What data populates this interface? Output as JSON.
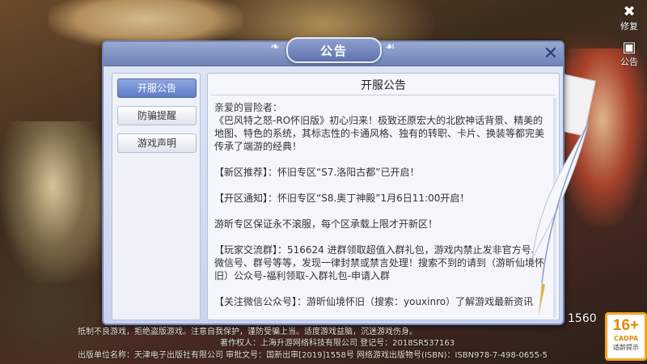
{
  "dialog": {
    "title": "公告",
    "close_icon": "close-x-icon"
  },
  "tabs": [
    {
      "label": "开服公告",
      "active": true
    },
    {
      "label": "防骗提醒",
      "active": false
    },
    {
      "label": "游戏声明",
      "active": false
    }
  ],
  "content": {
    "title": "开服公告",
    "paragraphs": [
      "亲爱的冒险者：",
      "《巴风特之怒-RO怀旧版》初心归来！极致还原宏大的北欧神话背景、精美的地图、特色的系统，其标志性的卡通风格、独有的转职、卡片、换装等都完美传承了端游的经典！",
      "【新区推荐】：怀旧专区“S7.洛阳古都”已开启！",
      "【开区通知】：怀旧专区“S8.奥丁神殿”1月6日11:00开启！",
      " 游昕专区保证永不滚服，每个区承载上限才开新区！",
      "【玩家交流群】：516624 进群领取超值入群礼包，游戏内禁止发非官方号、微信号、群号等等，发现一律封禁或禁言处理！搜索不到的请到（游昕仙境怀旧）公众号-福利领取-入群礼包-申请入群",
      "【关注微信公众号】：游昕仙境怀旧（搜索：youxinro）了解游戏最新资讯"
    ]
  },
  "top_buttons": {
    "repair": {
      "label": "修复",
      "icon": "wrench-icon"
    },
    "notice": {
      "label": "公告",
      "icon": "notice-icon"
    }
  },
  "legal": {
    "line1": "抵制不良游戏，拒绝盗版游戏。注意自我保护，谨防受骗上当。适度游戏益脑，沉迷游戏伤身。",
    "line2": "著作权人：上海升游网络科技有限公司 登记号：2018SR537163",
    "line3": "出版单位名称：天津电子出版社有限公司 审批文号：国新出审[2019]1558号 网络游戏出版物号(ISBN)：ISBN978-7-498-0655-5"
  },
  "version": "1560",
  "cadpa": {
    "age": "16+",
    "org": "CADPA",
    "tip": "适龄提示"
  },
  "colors": {
    "accent": "#6f82b6",
    "tab_active": "#5e7cc6",
    "close": "#2a3a78"
  }
}
